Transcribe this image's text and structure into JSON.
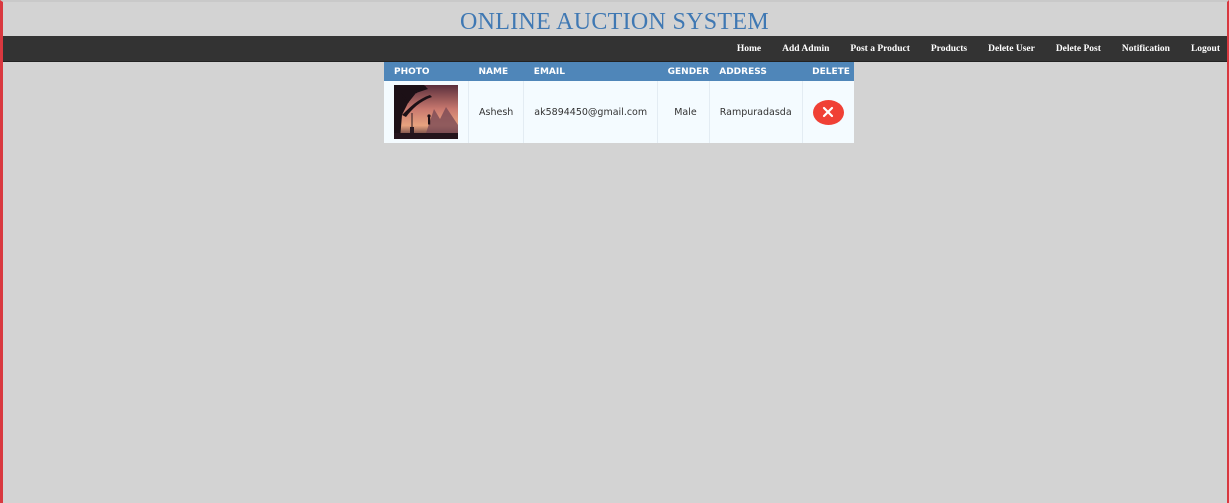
{
  "header": {
    "title": "ONLINE AUCTION SYSTEM"
  },
  "nav": {
    "items": [
      {
        "label": "Home"
      },
      {
        "label": "Add Admin"
      },
      {
        "label": "Post a Product"
      },
      {
        "label": "Products"
      },
      {
        "label": "Delete User"
      },
      {
        "label": "Delete Post"
      },
      {
        "label": "Notification"
      },
      {
        "label": "Logout"
      }
    ]
  },
  "table": {
    "columns": [
      "PHOTO",
      "NAME",
      "EMAIL",
      "GENDER",
      "ADDRESS",
      "DELETE"
    ],
    "rows": [
      {
        "photo_icon": "user-photo",
        "name": "Ashesh",
        "email": "ak5894450@gmail.com",
        "gender": "Male",
        "address": "Rampuradasda",
        "delete_icon": "close-icon"
      }
    ]
  },
  "colors": {
    "title": "#3f78b3",
    "navbar_bg": "#333333",
    "table_header_bg": "#4f86b9",
    "row_bg": "#f4fbff",
    "delete_button": "#f04035",
    "page_bg": "#d3d3d3"
  }
}
